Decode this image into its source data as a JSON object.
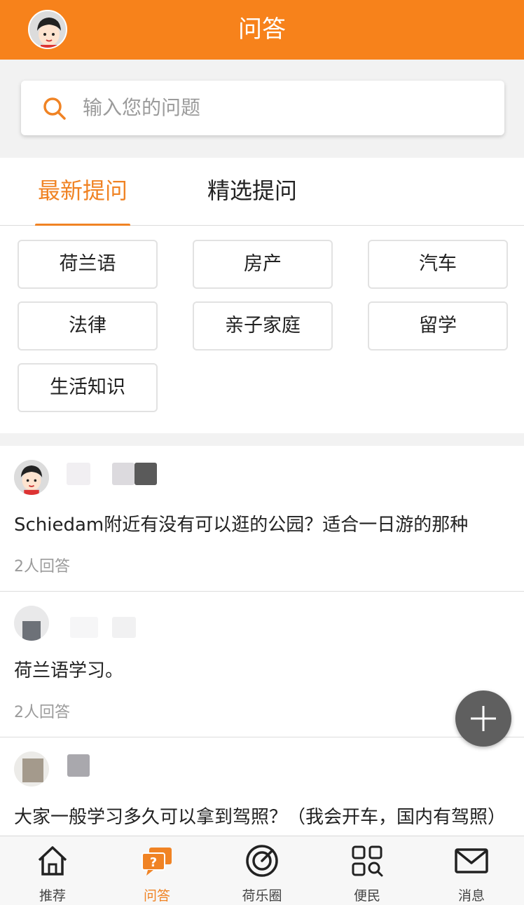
{
  "header": {
    "title": "问答",
    "avatar_icon": "user-avatar-icon"
  },
  "search": {
    "placeholder": "输入您的问题",
    "icon": "search-icon"
  },
  "tabs": [
    {
      "label": "最新提问",
      "active": true
    },
    {
      "label": "精选提问",
      "active": false
    }
  ],
  "categories": [
    "荷兰语",
    "房产",
    "汽车",
    "法律",
    "亲子家庭",
    "留学",
    "生活知识"
  ],
  "questions": [
    {
      "title": "Schiedam附近有没有可以逛的公园？适合一日游的那种",
      "answers": "2人回答"
    },
    {
      "title": "荷兰语学习。",
      "answers": "2人回答"
    },
    {
      "title": "大家一般学习多久可以拿到驾照？（我会开车，国内有驾照）",
      "answers": ""
    }
  ],
  "fab": {
    "icon": "plus-icon"
  },
  "tabbar": [
    {
      "label": "推荐",
      "icon": "home-icon",
      "active": false
    },
    {
      "label": "问答",
      "icon": "question-chat-icon",
      "active": true
    },
    {
      "label": "荷乐圈",
      "icon": "radar-icon",
      "active": false
    },
    {
      "label": "便民",
      "icon": "grid-search-icon",
      "active": false
    },
    {
      "label": "消息",
      "icon": "mail-icon",
      "active": false
    }
  ],
  "colors": {
    "accent": "#f7821b",
    "tab_active": "#f08324",
    "fab": "#5f5f5f"
  }
}
